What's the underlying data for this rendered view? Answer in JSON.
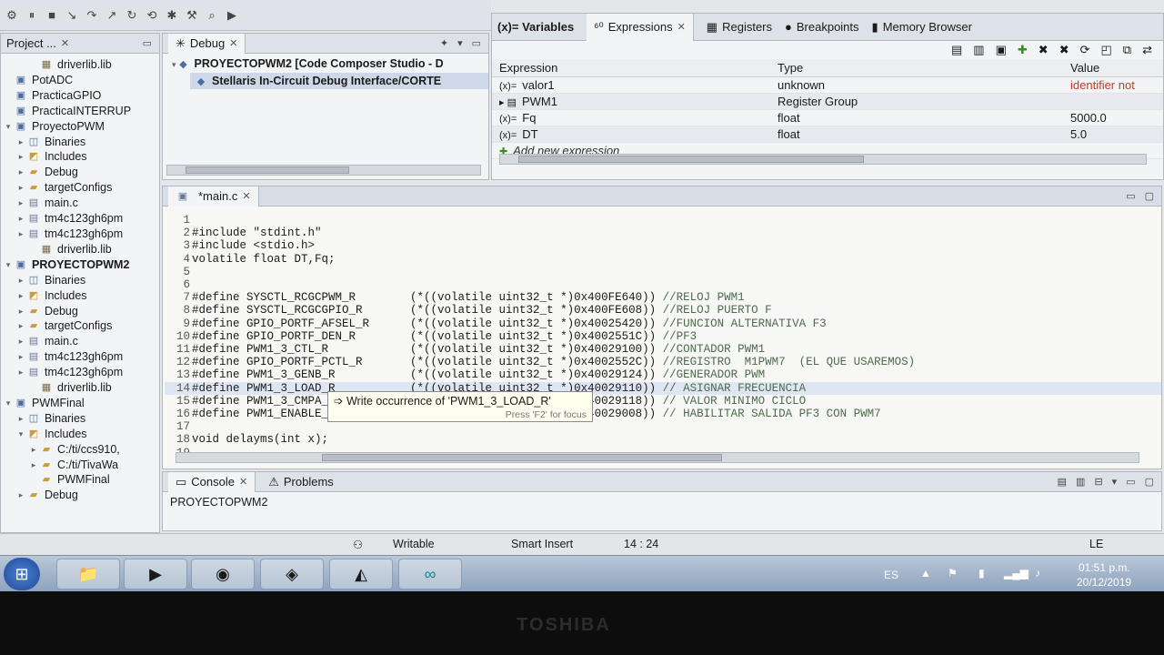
{
  "project_explorer": {
    "tab": "Project ...",
    "items": [
      {
        "label": "driverlib.lib",
        "indent": 2,
        "icon": "library-icon",
        "twisty": ""
      },
      {
        "label": "PotADC",
        "indent": 0,
        "icon": "project-icon",
        "twisty": ""
      },
      {
        "label": "PracticaGPIO",
        "indent": 0,
        "icon": "project-icon",
        "twisty": ""
      },
      {
        "label": "PracticaINTERRUP",
        "indent": 0,
        "icon": "project-icon",
        "twisty": ""
      },
      {
        "label": "ProyectoPWM",
        "indent": 0,
        "icon": "project-icon",
        "twisty": "▾"
      },
      {
        "label": "Binaries",
        "indent": 1,
        "icon": "binaries-icon",
        "twisty": "▸"
      },
      {
        "label": "Includes",
        "indent": 1,
        "icon": "includes-icon",
        "twisty": "▸"
      },
      {
        "label": "Debug",
        "indent": 1,
        "icon": "folder-icon",
        "twisty": "▸"
      },
      {
        "label": "targetConfigs",
        "indent": 1,
        "icon": "folder-icon",
        "twisty": "▸"
      },
      {
        "label": "main.c",
        "indent": 1,
        "icon": "c-file-icon",
        "twisty": "▸"
      },
      {
        "label": "tm4c123gh6pm",
        "indent": 1,
        "icon": "c-file-icon",
        "twisty": "▸"
      },
      {
        "label": "tm4c123gh6pm",
        "indent": 1,
        "icon": "c-file-icon",
        "twisty": "▸"
      },
      {
        "label": "driverlib.lib",
        "indent": 2,
        "icon": "library-icon",
        "twisty": ""
      },
      {
        "label": "PROYECTOPWM2",
        "indent": 0,
        "icon": "project-icon",
        "twisty": "▾",
        "bold": true
      },
      {
        "label": "Binaries",
        "indent": 1,
        "icon": "binaries-icon",
        "twisty": "▸"
      },
      {
        "label": "Includes",
        "indent": 1,
        "icon": "includes-icon",
        "twisty": "▸"
      },
      {
        "label": "Debug",
        "indent": 1,
        "icon": "folder-icon",
        "twisty": "▸"
      },
      {
        "label": "targetConfigs",
        "indent": 1,
        "icon": "folder-icon",
        "twisty": "▸"
      },
      {
        "label": "main.c",
        "indent": 1,
        "icon": "c-file-icon",
        "twisty": "▸"
      },
      {
        "label": "tm4c123gh6pm",
        "indent": 1,
        "icon": "c-file-icon",
        "twisty": "▸"
      },
      {
        "label": "tm4c123gh6pm",
        "indent": 1,
        "icon": "c-file-icon",
        "twisty": "▸"
      },
      {
        "label": "driverlib.lib",
        "indent": 2,
        "icon": "library-icon",
        "twisty": ""
      },
      {
        "label": "PWMFinal",
        "indent": 0,
        "icon": "project-icon",
        "twisty": "▾"
      },
      {
        "label": "Binaries",
        "indent": 1,
        "icon": "binaries-icon",
        "twisty": "▸"
      },
      {
        "label": "Includes",
        "indent": 1,
        "icon": "includes-icon",
        "twisty": "▾"
      },
      {
        "label": "C:/ti/ccs910,",
        "indent": 2,
        "icon": "folder-icon",
        "twisty": "▸"
      },
      {
        "label": "C:/ti/TivaWa",
        "indent": 2,
        "icon": "folder-icon",
        "twisty": "▸"
      },
      {
        "label": "PWMFinal",
        "indent": 2,
        "icon": "folder-icon",
        "twisty": ""
      },
      {
        "label": "Debug",
        "indent": 1,
        "icon": "folder-icon",
        "twisty": "▸"
      }
    ]
  },
  "debug": {
    "tab": "Debug",
    "rows": [
      "PROYECTOPWM2 [Code Composer Studio - D",
      "Stellaris In-Circuit Debug Interface/CORTE"
    ]
  },
  "views": {
    "variables": "(x)= Variables",
    "expressions": "Expressions",
    "registers": "Registers",
    "breakpoints": "Breakpoints",
    "memory": "Memory Browser"
  },
  "expressions": {
    "headers": {
      "expression": "Expression",
      "type": "Type",
      "value": "Value"
    },
    "rows": [
      {
        "name": "valor1",
        "type": "unknown",
        "value": "identifier not",
        "error": true
      },
      {
        "name": "PWM1",
        "type": "Register Group",
        "value": ""
      },
      {
        "name": "Fq",
        "type": "float",
        "value": "5000.0"
      },
      {
        "name": "DT",
        "type": "float",
        "value": "5.0"
      }
    ],
    "add_new": "Add new expression"
  },
  "editor": {
    "tab": "*main.c",
    "lines": [
      {
        "n": "1",
        "t": ""
      },
      {
        "n": "2",
        "t": "#include \"stdint.h\""
      },
      {
        "n": "3",
        "t": "#include <stdio.h>"
      },
      {
        "n": "4",
        "t": "volatile float DT,Fq;"
      },
      {
        "n": "5",
        "t": ""
      },
      {
        "n": "6",
        "t": ""
      },
      {
        "n": "7",
        "t": "#define SYSCTL_RCGCPWM_R        (*((volatile uint32_t *)0x400FE640)) //RELOJ PWM1"
      },
      {
        "n": "8",
        "t": "#define SYSCTL_RCGCGPIO_R       (*((volatile uint32_t *)0x400FE608)) //RELOJ PUERTO F"
      },
      {
        "n": "9",
        "t": "#define GPIO_PORTF_AFSEL_R      (*((volatile uint32_t *)0x40025420)) //FUNCION ALTERNATIVA F3"
      },
      {
        "n": "10",
        "t": "#define GPIO_PORTF_DEN_R        (*((volatile uint32_t *)0x4002551C)) //PF3"
      },
      {
        "n": "11",
        "t": "#define PWM1_3_CTL_R            (*((volatile uint32_t *)0x40029100)) //CONTADOR PWM1"
      },
      {
        "n": "12",
        "t": "#define GPIO_PORTF_PCTL_R       (*((volatile uint32_t *)0x4002552C)) //REGISTRO  M1PWM7  (EL QUE USAREMOS)"
      },
      {
        "n": "13",
        "t": "#define PWM1_3_GENB_R           (*((volatile uint32_t *)0x40029124)) //GENERADOR PWM"
      },
      {
        "n": "14",
        "t": "#define PWM1_3_LOAD_R           (*((volatile uint32_t *)0x40029110)) // ASIGNAR FRECUENCIA"
      },
      {
        "n": "15",
        "t": "#define PWM1_3_CMPA_R           (*((volatile uint32_t *)0x40029118)) // VALOR MINIMO CICLO"
      },
      {
        "n": "16",
        "t": "#define PWM1_ENABLE_R           (*((volatile uint32_t *)0x40029008)) // HABILITAR SALIDA PF3 CON PWM7"
      },
      {
        "n": "17",
        "t": ""
      },
      {
        "n": "18",
        "t": "void delayms(int x);"
      },
      {
        "n": "19",
        "t": ""
      }
    ]
  },
  "tooltip": {
    "text": "Write occurrence of 'PWM1_3_LOAD_R'",
    "hint": "Press 'F2' for focus"
  },
  "console": {
    "tab": "Console",
    "problems_tab": "Problems",
    "content": "PROYECTOPWM2"
  },
  "status": {
    "writable": "Writable",
    "insert_mode": "Smart Insert",
    "position": "14 : 24",
    "extra": "LE"
  },
  "taskbar": {
    "apps": [
      "folder-icon",
      "media-player-icon",
      "chrome-icon",
      "app-icon",
      "ccs-icon",
      "arduino-icon"
    ],
    "lang": "ES",
    "time": "01:51 p.m.",
    "date": "20/12/2019"
  },
  "bezel_brand": "TOSHIBA"
}
